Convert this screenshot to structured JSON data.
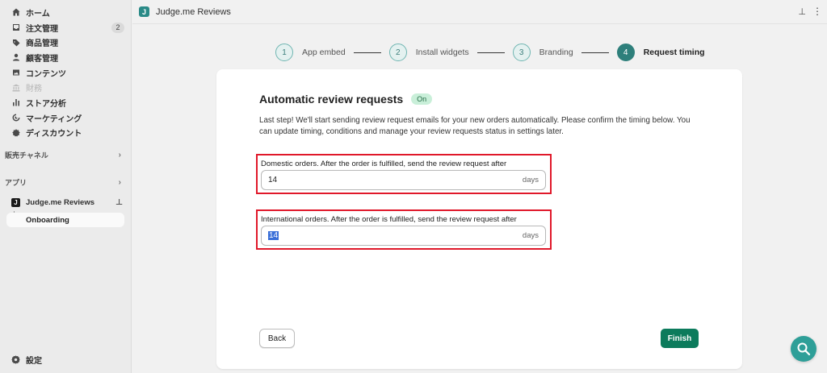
{
  "sidebar": {
    "items": [
      {
        "label": "ホーム",
        "icon": "home-icon"
      },
      {
        "label": "注文管理",
        "icon": "inbox-icon",
        "badge": "2"
      },
      {
        "label": "商品管理",
        "icon": "tag-icon"
      },
      {
        "label": "顧客管理",
        "icon": "person-icon"
      },
      {
        "label": "コンテンツ",
        "icon": "image-icon"
      },
      {
        "label": "財務",
        "icon": "bank-icon",
        "disabled": true
      },
      {
        "label": "ストア分析",
        "icon": "bar-chart-icon"
      },
      {
        "label": "マーケティング",
        "icon": "target-icon"
      },
      {
        "label": "ディスカウント",
        "icon": "discount-icon"
      }
    ],
    "sales_channels": "販売チャネル",
    "apps": "アプリ",
    "app_name": "Judge.me Reviews",
    "app_logo_letter": "J",
    "sub_item": "Onboarding",
    "settings": "設定"
  },
  "topbar": {
    "logo_letter": "J",
    "title": "Judge.me Reviews",
    "more": "⋮"
  },
  "stepper": [
    {
      "num": "1",
      "label": "App embed"
    },
    {
      "num": "2",
      "label": "Install widgets"
    },
    {
      "num": "3",
      "label": "Branding"
    },
    {
      "num": "4",
      "label": "Request timing",
      "active": true
    }
  ],
  "card": {
    "title": "Automatic review requests",
    "status": "On",
    "description": "Last step! We'll start sending review request emails for your new orders automatically. Please confirm the timing below. You can update timing, conditions and manage your review requests status in settings later.",
    "domestic_label": "Domestic orders. After the order is fulfilled, send the review request after",
    "domestic_value": "14",
    "international_label": "International orders. After the order is fulfilled, send the review request after",
    "international_value": "14",
    "suffix": "days",
    "back_label": "Back",
    "finish_label": "Finish"
  },
  "colors": {
    "accent_teal": "#2e7f7b",
    "finish_green": "#0c7b5c",
    "highlight_red": "#e0182a",
    "badge_green": "#c9efd9"
  }
}
